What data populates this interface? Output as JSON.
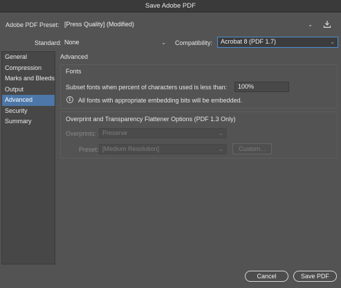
{
  "window": {
    "title": "Save Adobe PDF"
  },
  "preset": {
    "label": "Adobe PDF Preset:",
    "value": "[Press Quality] (Modified)",
    "save_icon": "save-preset-icon"
  },
  "standard": {
    "label": "Standard:",
    "value": "None"
  },
  "compatibility": {
    "label": "Compatibility:",
    "value": "Acrobat 8 (PDF 1.7)"
  },
  "sidebar": {
    "items": [
      {
        "label": "General"
      },
      {
        "label": "Compression"
      },
      {
        "label": "Marks and Bleeds"
      },
      {
        "label": "Output"
      },
      {
        "label": "Advanced"
      },
      {
        "label": "Security"
      },
      {
        "label": "Summary"
      }
    ],
    "active_index": 4
  },
  "main": {
    "heading": "Advanced",
    "fonts": {
      "title": "Fonts",
      "subset_label": "Subset fonts when percent of characters used is less than:",
      "subset_value": "100%",
      "info_text": "All fonts with appropriate embedding bits will be embedded."
    },
    "overprint": {
      "title": "Overprint and Transparency Flattener Options (PDF 1.3 Only)",
      "overprints_label": "Overprints:",
      "overprints_value": "Preserve",
      "preset_label": "Preset:",
      "preset_value": "[Medium Resolution]",
      "custom_label": "Custom..."
    }
  },
  "buttons": {
    "cancel": "Cancel",
    "save": "Save PDF"
  },
  "colors": {
    "accent": "#4c77a8",
    "focus": "#4f8fd6",
    "background": "#535353"
  }
}
